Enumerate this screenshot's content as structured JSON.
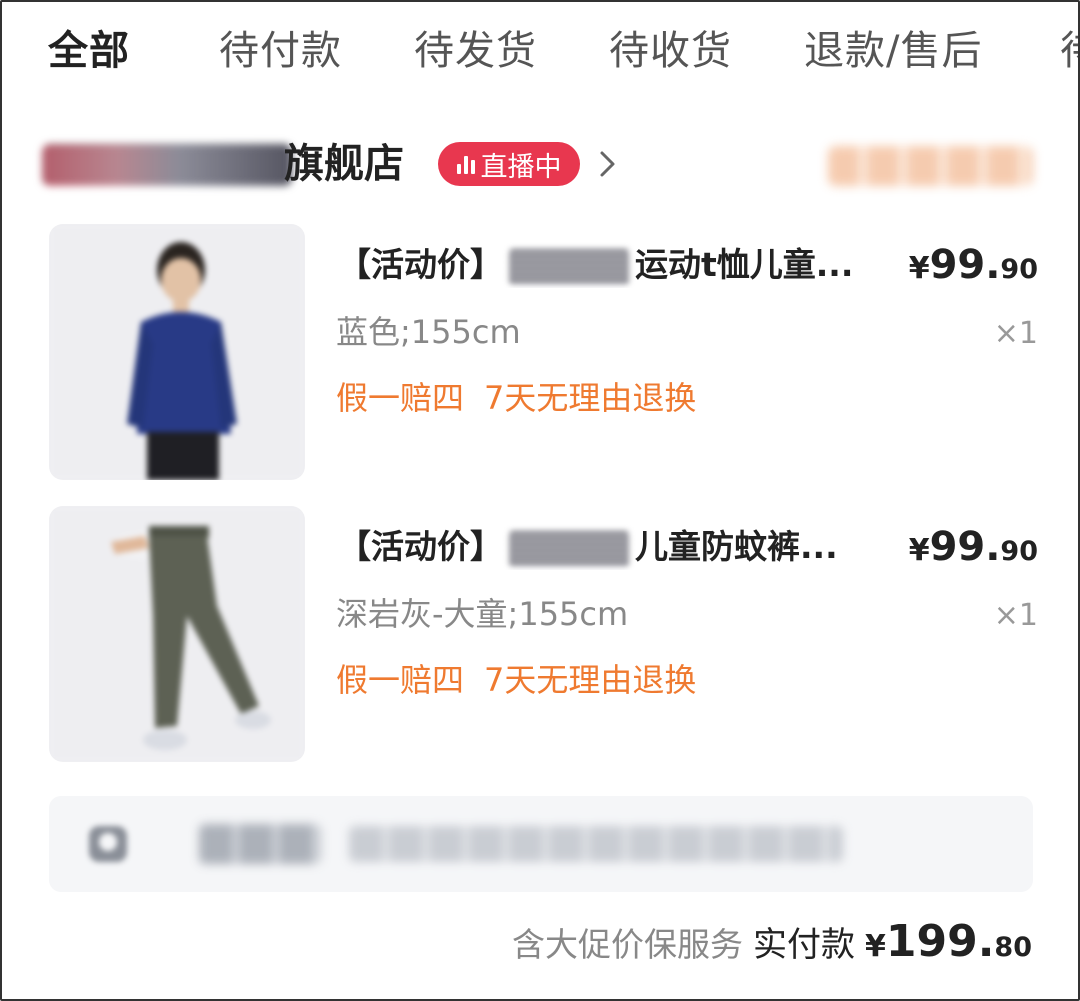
{
  "tabs": [
    {
      "label": "全部",
      "active": true
    },
    {
      "label": "待付款"
    },
    {
      "label": "待发货"
    },
    {
      "label": "待收货"
    },
    {
      "label": "退款/售后"
    },
    {
      "label": "待"
    }
  ],
  "shop": {
    "name_suffix": "旗舰店",
    "live_label": "直播中"
  },
  "items": [
    {
      "title_prefix": "【活动价】",
      "title_suffix": "运动t恤儿童...",
      "price_currency": "¥",
      "price_int": "99.",
      "price_dec": "90",
      "sku": "蓝色;155cm",
      "qty": "×1",
      "tags": [
        "假一赔四",
        "7天无理由退换"
      ]
    },
    {
      "title_prefix": "【活动价】",
      "title_suffix": "儿童防蚊裤...",
      "price_currency": "¥",
      "price_int": "99.",
      "price_dec": "90",
      "sku": "深岩灰-大童;155cm",
      "qty": "×1",
      "tags": [
        "假一赔四",
        "7天无理由退换"
      ]
    }
  ],
  "footer": {
    "note": "含大促价保服务",
    "paid_label": "实付款",
    "currency": "¥",
    "amount_int": "199.",
    "amount_dec": "80"
  },
  "colors": {
    "live_badge": "#e8374f",
    "service_tag": "#ef7a30",
    "logistics_bg": "#f5f6f8"
  }
}
